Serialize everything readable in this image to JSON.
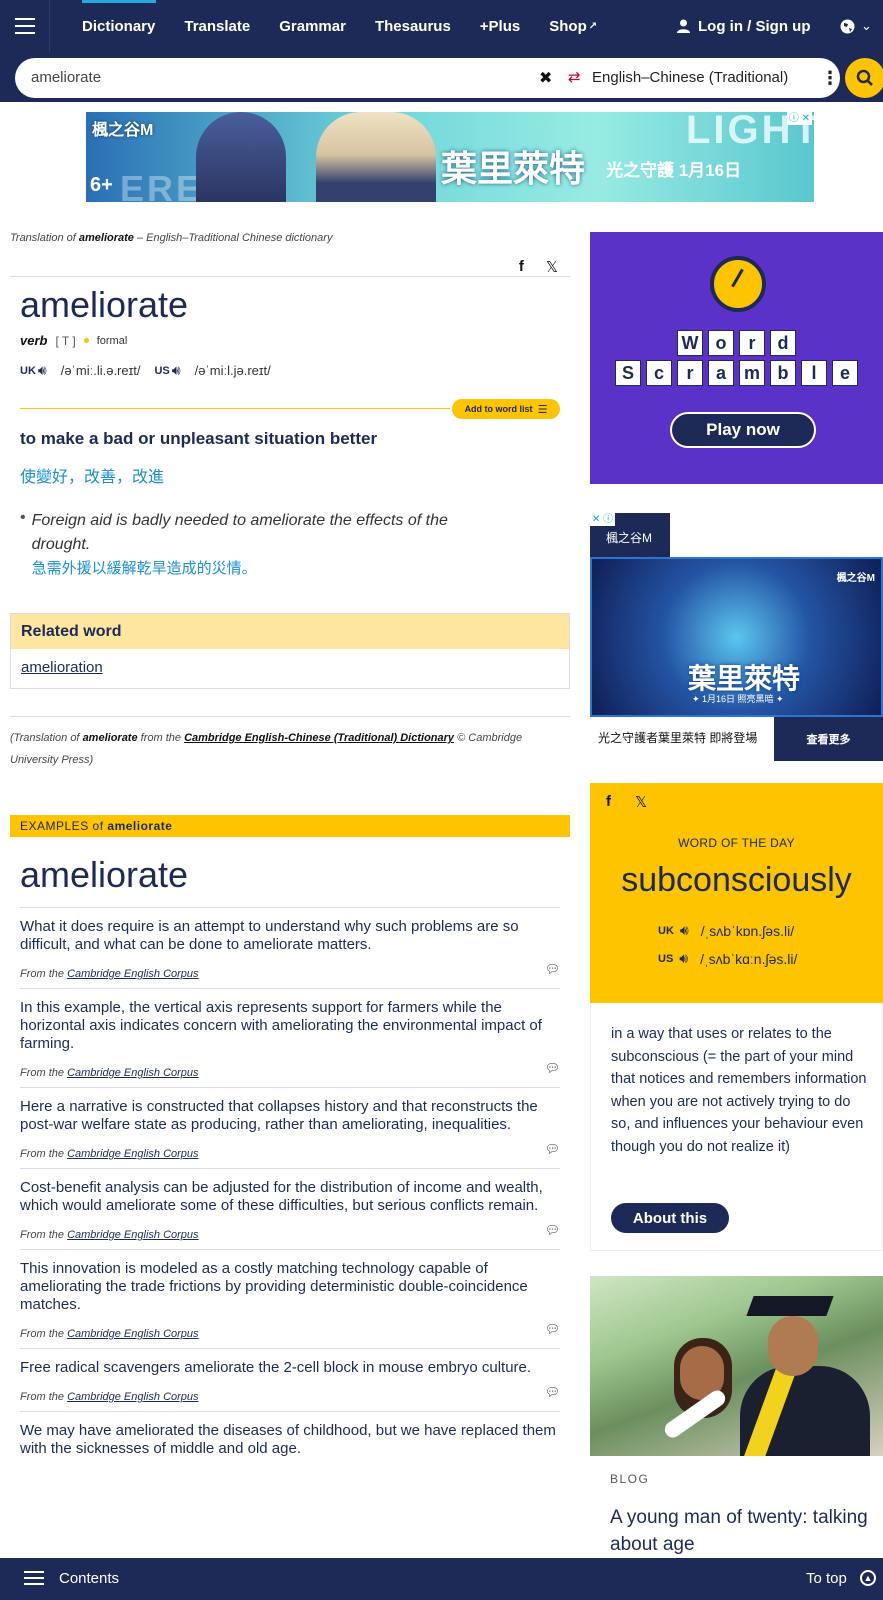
{
  "nav": {
    "links": [
      "Dictionary",
      "Translate",
      "Grammar",
      "Thesaurus",
      "+Plus",
      "Shop"
    ],
    "login": "Log in / Sign up"
  },
  "search": {
    "query": "ameliorate",
    "language": "English–Chinese (Traditional)"
  },
  "top_ad": {
    "logo": "楓之谷M",
    "title": "葉里萊特",
    "subtitle": "光之守護 1月16日",
    "bg_word_1": "LIGHT",
    "bg_word_2": "EREL",
    "rating": "6+"
  },
  "entry": {
    "breadcrumb_prefix": "Translation of",
    "breadcrumb_word": "ameliorate",
    "breadcrumb_suffix": "– English–Traditional Chinese dictionary",
    "headword": "ameliorate",
    "pos": "verb",
    "grammar_code": "[ T ]",
    "register": "formal",
    "uk_label": "UK",
    "uk_ipa": "/əˈmiː.li.ə.reɪt/",
    "us_label": "US",
    "us_ipa": "/əˈmiːl.jə.reɪt/",
    "add_to_word_list": "Add to word list",
    "definition": "to make a bad or unpleasant situation better",
    "translation": "使變好，改善，改進",
    "example_en": "Foreign aid is badly needed to ameliorate the effects of the drought.",
    "example_zh": "急需外援以緩解乾旱造成的災情。",
    "related_heading": "Related word",
    "related_word": "amelioration",
    "citation_1": "(Translation of",
    "citation_word": "ameliorate",
    "citation_2": "from the",
    "citation_dict": "Cambridge English-Chinese (Traditional) Dictionary",
    "citation_3": "© Cambridge University Press)"
  },
  "examples": {
    "bar_prefix": "EXAMPLES of",
    "bar_word": "ameliorate",
    "heading": "ameliorate",
    "from": "From the",
    "corpus": "Cambridge English Corpus",
    "items": [
      "What it does require is an attempt to understand why such problems are so difficult, and what can be done to ameliorate matters.",
      "In this example, the vertical axis represents support for farmers while the horizontal axis indicates concern with ameliorating the environmental impact of farming.",
      "Here a narrative is constructed that collapses history and that reconstructs the post-war welfare state as producing, rather than ameliorating, inequalities.",
      "Cost-benefit analysis can be adjusted for the distribution of income and wealth, which would ameliorate some of these difficulties, but serious conflicts remain.",
      "This innovation is modeled as a costly matching technology capable of ameliorating the trade frictions by providing deterministic double-coincidence matches.",
      "Free radical scavengers ameliorate the 2-cell block in mouse embryo culture.",
      "We may have ameliorated the diseases of childhood, but we have replaced them with the sicknesses of middle and old age."
    ]
  },
  "scramble": {
    "row1": [
      "W",
      "o",
      "r",
      "d"
    ],
    "row2": [
      "S",
      "c",
      "r",
      "a",
      "m",
      "b",
      "l",
      "e"
    ],
    "play": "Play now"
  },
  "side_ad": {
    "tab": "楓之谷M",
    "logo": "楓之谷M",
    "title": "葉里萊特",
    "subtitle": "✦ 1月16日 照亮黑暗 ✦",
    "caption": "光之守護者葉里萊特 即將登場",
    "more": "查看更多"
  },
  "wotd": {
    "label": "WORD OF THE DAY",
    "word": "subconsciously",
    "uk_label": "UK",
    "uk_ipa": "/ˌsʌbˈkɒn.ʃəs.li/",
    "us_label": "US",
    "us_ipa": "/ˌsʌbˈkɑːn.ʃəs.li/",
    "definition": "in a way that uses or relates to the subconscious (= the part of your mind that notices and remembers information when you are not actively trying to do so, and influences your behaviour even though you do not realize it)",
    "about": "About this"
  },
  "blog": {
    "label": "BLOG",
    "title": "A young man of twenty: talking about age"
  },
  "bottom": {
    "contents": "Contents",
    "to_top": "To top"
  },
  "colors": {
    "navy": "#1d2a57",
    "yellow": "#ffc400",
    "link_blue": "#1a8fd3",
    "purple": "#5a32c8"
  }
}
